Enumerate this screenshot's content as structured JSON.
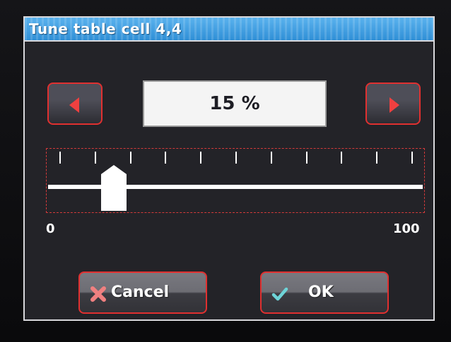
{
  "dialog": {
    "title": "Tune table cell 4,4",
    "value_display": "15 %"
  },
  "slider": {
    "min_label": "0",
    "max_label": "100",
    "value": 15,
    "tick_count": 11
  },
  "buttons": {
    "decrement_icon": "arrow-left-icon",
    "increment_icon": "arrow-right-icon",
    "cancel_label": "Cancel",
    "cancel_icon": "x-mark-icon",
    "ok_label": "OK",
    "ok_icon": "checkmark-icon"
  },
  "colors": {
    "title_bar": "#3d9be0",
    "button_border": "#e03030",
    "arrow": "#f04040",
    "cancel_icon": "#f08080",
    "ok_icon": "#6ed4d8"
  }
}
